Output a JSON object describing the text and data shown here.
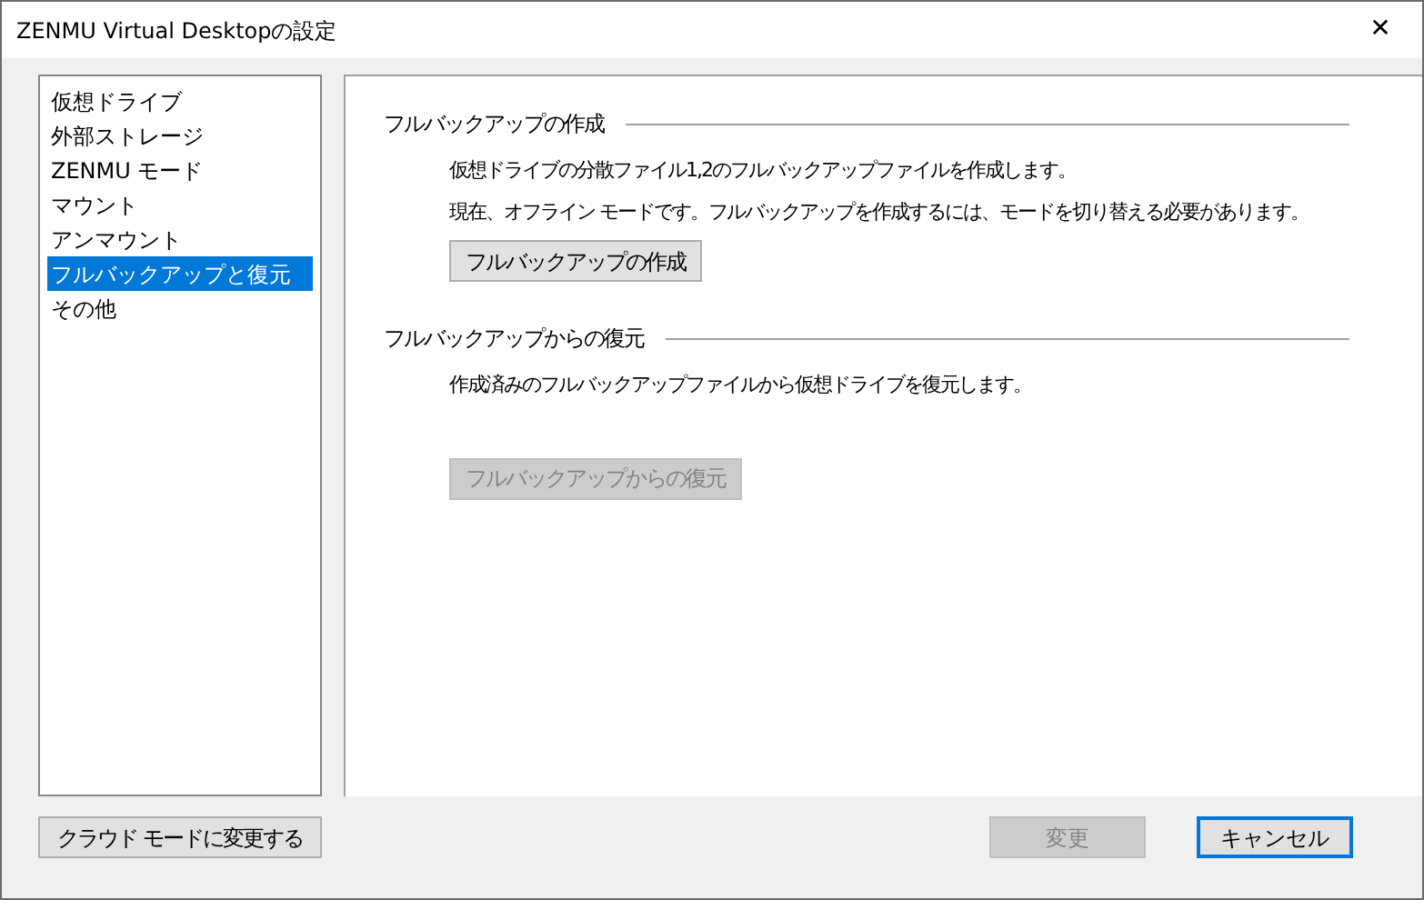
{
  "window": {
    "title": "ZENMU Virtual Desktopの設定",
    "close": "✕"
  },
  "sidebar": {
    "items": [
      {
        "label": "仮想ドライブ",
        "selected": false
      },
      {
        "label": "外部ストレージ",
        "selected": false
      },
      {
        "label": "ZENMU モード",
        "selected": false
      },
      {
        "label": "マウント",
        "selected": false
      },
      {
        "label": "アンマウント",
        "selected": false
      },
      {
        "label": "フルバックアップと復元",
        "selected": true
      },
      {
        "label": "その他",
        "selected": false
      }
    ]
  },
  "sections": [
    {
      "title": "フルバックアップの作成",
      "lines": [
        "仮想ドライブの分散ファイル1,2のフルバックアップファイルを作成します。",
        "現在、オフライン モードです。フルバックアップを作成するには、モードを切り替える必要があります。"
      ],
      "button": {
        "label": "フルバックアップの作成",
        "disabled": false
      }
    },
    {
      "title": "フルバックアップからの復元",
      "lines": [
        "作成済みのフルバックアップファイルから仮想ドライブを復元します。"
      ],
      "button": {
        "label": "フルバックアップからの復元",
        "disabled": true
      }
    }
  ],
  "footer": {
    "mode_button": {
      "label": "クラウド モードに変更する",
      "disabled": false
    },
    "apply_button": {
      "label": "変更",
      "disabled": true
    },
    "cancel_button": {
      "label": "キャンセル",
      "disabled": false,
      "default": true
    }
  }
}
